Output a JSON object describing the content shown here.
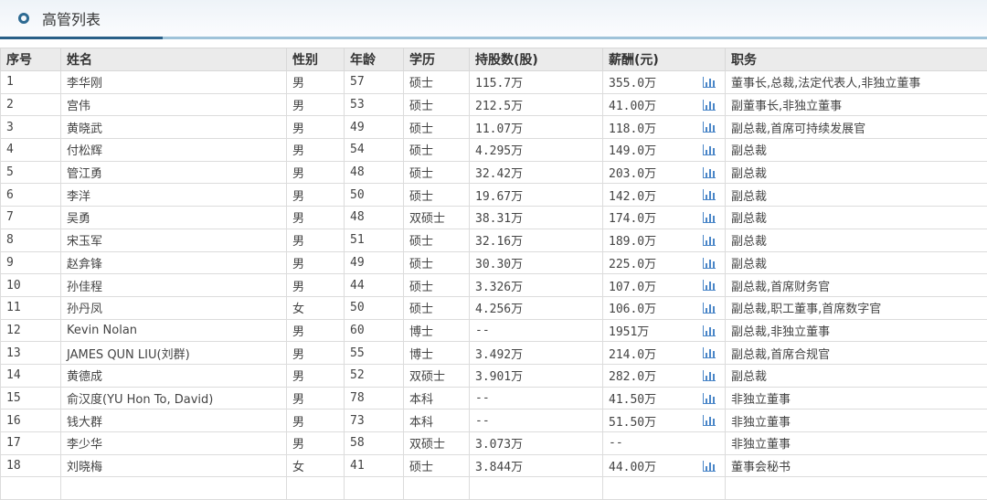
{
  "title": "高管列表",
  "columns": [
    "序号",
    "姓名",
    "性别",
    "年龄",
    "学历",
    "持股数(股)",
    "薪酬(元)",
    "职务"
  ],
  "rows": [
    [
      "1",
      "李华刚",
      "男",
      "57",
      "硕士",
      "115.7万",
      "355.0万",
      true,
      "董事长,总裁,法定代表人,非独立董事"
    ],
    [
      "2",
      "宫伟",
      "男",
      "53",
      "硕士",
      "212.5万",
      "41.00万",
      true,
      "副董事长,非独立董事"
    ],
    [
      "3",
      "黄晓武",
      "男",
      "49",
      "硕士",
      "11.07万",
      "118.0万",
      true,
      "副总裁,首席可持续发展官"
    ],
    [
      "4",
      "付松辉",
      "男",
      "54",
      "硕士",
      "4.295万",
      "149.0万",
      true,
      "副总裁"
    ],
    [
      "5",
      "管江勇",
      "男",
      "48",
      "硕士",
      "32.42万",
      "203.0万",
      true,
      "副总裁"
    ],
    [
      "6",
      "李洋",
      "男",
      "50",
      "硕士",
      "19.67万",
      "142.0万",
      true,
      "副总裁"
    ],
    [
      "7",
      "吴勇",
      "男",
      "48",
      "双硕士",
      "38.31万",
      "174.0万",
      true,
      "副总裁"
    ],
    [
      "8",
      "宋玉军",
      "男",
      "51",
      "硕士",
      "32.16万",
      "189.0万",
      true,
      "副总裁"
    ],
    [
      "9",
      "赵弇锋",
      "男",
      "49",
      "硕士",
      "30.30万",
      "225.0万",
      true,
      "副总裁"
    ],
    [
      "10",
      "孙佳程",
      "男",
      "44",
      "硕士",
      "3.326万",
      "107.0万",
      true,
      "副总裁,首席财务官"
    ],
    [
      "11",
      "孙丹凤",
      "女",
      "50",
      "硕士",
      "4.256万",
      "106.0万",
      true,
      "副总裁,职工董事,首席数字官"
    ],
    [
      "12",
      "Kevin Nolan",
      "男",
      "60",
      "博士",
      "--",
      "1951万",
      true,
      "副总裁,非独立董事"
    ],
    [
      "13",
      "JAMES QUN LIU(刘群)",
      "男",
      "55",
      "博士",
      "3.492万",
      "214.0万",
      true,
      "副总裁,首席合规官"
    ],
    [
      "14",
      "黄德成",
      "男",
      "52",
      "双硕士",
      "3.901万",
      "282.0万",
      true,
      "副总裁"
    ],
    [
      "15",
      "俞汉度(YU Hon To, David)",
      "男",
      "78",
      "本科",
      "--",
      "41.50万",
      true,
      "非独立董事"
    ],
    [
      "16",
      "钱大群",
      "男",
      "73",
      "本科",
      "--",
      "51.50万",
      true,
      "非独立董事"
    ],
    [
      "17",
      "李少华",
      "男",
      "58",
      "双硕士",
      "3.073万",
      "--",
      false,
      "非独立董事"
    ],
    [
      "18",
      "刘晓梅",
      "女",
      "41",
      "硕士",
      "3.844万",
      "44.00万",
      true,
      "董事会秘书"
    ]
  ],
  "icon": "bar-chart-icon"
}
